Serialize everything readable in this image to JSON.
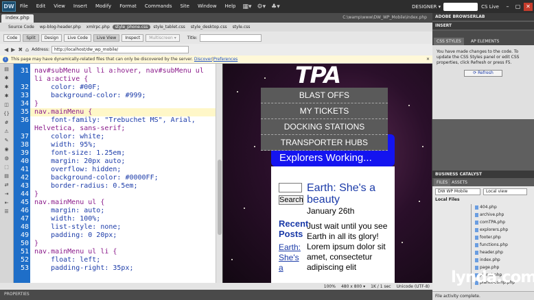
{
  "app": {
    "logo": "DW",
    "menus": [
      "File",
      "Edit",
      "View",
      "Insert",
      "Modify",
      "Format",
      "Commands",
      "Site",
      "Window",
      "Help"
    ],
    "workspace": "DESIGNER ▾",
    "cs_live": "CS Live"
  },
  "document": {
    "tab": "index.php",
    "path": "C:\\wamp\\www\\DW_WP_Mobile\\index.php",
    "related_files": [
      "Source Code",
      "wp-blog-header.php",
      "xmlrpc.php",
      "style_phone.css",
      "style_tablet.css",
      "style_desktop.css",
      "style.css"
    ],
    "active_related_index": 3
  },
  "toolbar": {
    "code_label": "Code",
    "split_label": "Split",
    "design_label": "Design",
    "livecode_label": "Live Code",
    "liveview_label": "Live View",
    "inspect_label": "Inspect",
    "multiscreen_label": "Multiscreen ▾",
    "title_label": "Title:"
  },
  "address": {
    "label": "Address:",
    "url": "http://localhost/dw_wp_mobile/"
  },
  "infobar": {
    "message": "This page may have dynamically-related files that can only be discovered by the server.",
    "discover": "Discover",
    "sep": " | ",
    "preferences": "Preferences"
  },
  "code": {
    "line_numbers": [
      "31",
      "",
      "32",
      "33",
      "34",
      "35",
      "36",
      "",
      "37",
      "38",
      "39",
      "40",
      "41",
      "42",
      "43",
      "44",
      "45",
      "46",
      "47",
      "48",
      "49",
      "50",
      "51",
      "52",
      "53"
    ],
    "lines": [
      "nav#subMenu ul li a:hover, nav#subMenu ul",
      "li a:active {",
      "    color: #00F;",
      "    background-color: #999;",
      "}",
      "nav.mainMenu {",
      "    font-family: \"Trebuchet MS\", Arial,",
      "Helvetica, sans-serif;",
      "    color: white;",
      "    width: 95%;",
      "    font-size: 1.25em;",
      "    margin: 20px auto;",
      "    overflow: hidden;",
      "    background-color: #0000FF;",
      "    border-radius: 0.5em;",
      "}",
      "nav.mainMenu ul {",
      "    margin: auto;",
      "    width: 100%;",
      "    list-style: none;",
      "    padding: 0 20px;",
      "}",
      "nav.mainMenu ul li {",
      "    float: left;",
      "    padding-right: 35px;"
    ]
  },
  "live": {
    "logo": "TPA",
    "nav": [
      "BLAST OFFS",
      "MY TICKETS",
      "DOCKING STATIONS",
      "TRANSPORTER HUBS"
    ],
    "bluebar_text": "Explorers    Working...",
    "search_button": "Search",
    "post_title": "Earth: She's a beauty",
    "post_date": "January 26th",
    "post_body": "Just wait until you see Earth in all its glory! Lorem ipsum dolor sit amet, consectetur adipiscing elit",
    "recent": "Recent Posts",
    "recent_link": "Earth: She's a"
  },
  "status": {
    "zoom": "100%",
    "size": "480 x 800 ▾",
    "speed": "1K / 1 sec",
    "encoding": "Unicode (UTF-8)"
  },
  "properties_label": "PROPERTIES",
  "right": {
    "browserlab": "ADOBE BROWSERLAB",
    "insert": "INSERT",
    "tab_css": "CSS STYLES",
    "tab_ap": "AP ELEMENTS",
    "css_message": "You have made changes to the code. To update the CSS Styles panel or edit CSS properties, click Refresh or press F5.",
    "refresh": "Refresh",
    "business_catalyst": "BUSINESS CATALYST",
    "tab_files": "FILES",
    "tab_assets": "ASSETS",
    "site": "DW WP Mobile",
    "view": "Local view",
    "local_files": "Local Files",
    "files": [
      "404.php",
      "archive.php",
      "comTPA.php",
      "explorers.php",
      "footer.php",
      "functions.php",
      "header.php",
      "index.php",
      "page.php",
      "planet.php",
      "planet-comp.php"
    ],
    "status": "File activity complete."
  },
  "watermark": "lynda.com"
}
